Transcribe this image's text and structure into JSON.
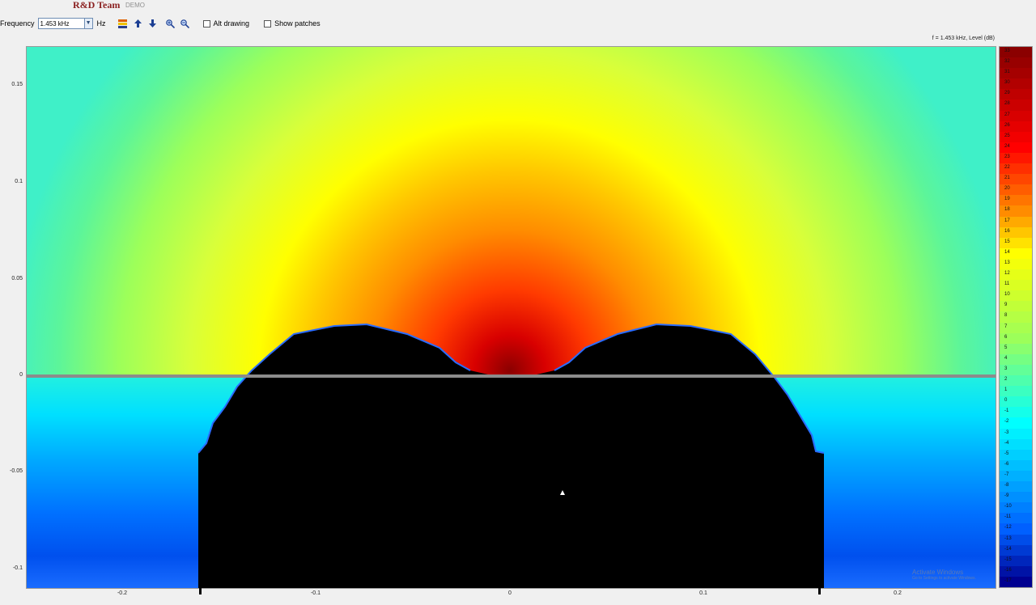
{
  "header": {
    "logo": "R&D Team",
    "demo": "DEMO"
  },
  "toolbar": {
    "frequency_label": "Frequency",
    "frequency_value": "1.453 kHz",
    "unit": "Hz",
    "icons": [
      "spectrum-icon",
      "arrow-up-icon",
      "arrow-down-icon",
      "zoom-in-icon",
      "zoom-out-icon"
    ],
    "alt_drawing": {
      "label": "Alt drawing",
      "checked": false
    },
    "show_patches": {
      "label": "Show patches",
      "checked": false
    }
  },
  "plot": {
    "title": "f = 1.453 kHz, Level  (dB)",
    "y_ticks": [
      "0.15",
      "0.1",
      "0.05",
      "0",
      "-0.05",
      "-0.1"
    ],
    "x_ticks": [
      "-0.2",
      "-0.1",
      "0",
      "0.1",
      "0.2"
    ]
  },
  "colorbar": {
    "min": -17,
    "max": 33,
    "labels": [
      "33",
      "32",
      "31",
      "30",
      "29",
      "28",
      "27",
      "26",
      "25",
      "24",
      "23",
      "22",
      "21",
      "20",
      "19",
      "18",
      "17",
      "16",
      "15",
      "14",
      "13",
      "12",
      "11",
      "10",
      "9",
      "8",
      "7",
      "6",
      "5",
      "4",
      "3",
      "2",
      "1",
      "0",
      "-1",
      "-2",
      "-3",
      "-4",
      "-5",
      "-6",
      "-7",
      "-8",
      "-9",
      "-10",
      "-11",
      "-12",
      "-13",
      "-14",
      "-15",
      "-16",
      "-17"
    ],
    "colors": {
      "dark_red": "#8b0000",
      "red": "#ff0000",
      "orange": "#ff8c00",
      "yellow": "#ffff00",
      "green": "#9cff5a",
      "cyan": "#00ffff",
      "blue": "#0060ff",
      "dark_blue": "#000090"
    }
  },
  "watermark": {
    "line1": "Activate Windows",
    "line2": "Go to Settings to activate Windows."
  }
}
